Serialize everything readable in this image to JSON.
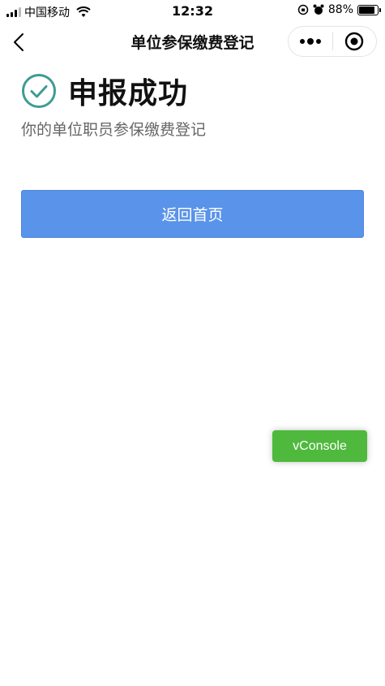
{
  "status_bar": {
    "carrier": "中国移动",
    "time": "12:32",
    "battery_text": "88%",
    "battery_level": 0.88
  },
  "nav": {
    "title": "单位参保缴费登记"
  },
  "result": {
    "title": "申报成功",
    "description": "你的单位职员参保缴费登记"
  },
  "actions": {
    "home_label": "返回首页"
  },
  "debug": {
    "vconsole_label": "vConsole"
  },
  "colors": {
    "primary_button": "#5a93ea",
    "success_icon": "#3e9c94",
    "vconsole": "#4fb93d"
  }
}
